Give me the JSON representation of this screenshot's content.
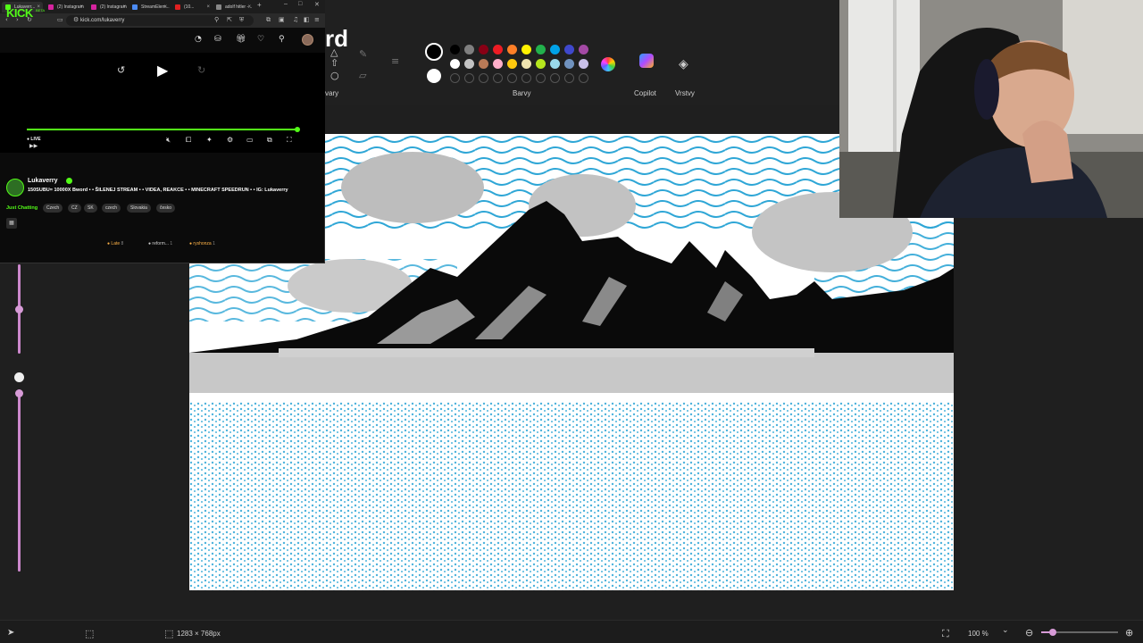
{
  "browser": {
    "tabs": [
      {
        "label": "Lukaverr...",
        "fav": "#53fc18",
        "active": true
      },
      {
        "label": "(2) Instagram",
        "fav": "#d6249f",
        "active": false
      },
      {
        "label": "(2) Instagram",
        "fav": "#d6249f",
        "active": false
      },
      {
        "label": "StreamElem...",
        "fav": "#4b8bf5",
        "active": false
      },
      {
        "label": "(10...",
        "fav": "#e02020",
        "active": false
      },
      {
        "label": "adolf hitler -...",
        "fav": "#888888",
        "active": false
      }
    ],
    "url": "kick.com/lukaverry"
  },
  "kick": {
    "logo": "KICK",
    "logo_badge": "BETA",
    "live_label": "LIVE",
    "channel": {
      "name": "Lukaverry",
      "title": "150SUBU= 10000X Bword • • ŠILENEJ STREAM • • VIDEA, REAKCE • • MINECRAFT SPEEDRUN • • IG: Lukaverry",
      "category": "Just Chatting",
      "tags": [
        "Czech",
        "CZ",
        "SK",
        "czech",
        "Slovakia",
        "česko"
      ]
    },
    "chat_users": [
      {
        "name": "Late",
        "count": "8"
      },
      {
        "name": "reform...",
        "count": "1"
      },
      {
        "name": "ryshonza",
        "count": "1"
      }
    ]
  },
  "paint": {
    "title_fragment": "rd",
    "groups": {
      "tools_label": "vary",
      "colors_label": "Barvy",
      "copilot_label": "Copilot",
      "layers_label": "Vrstvy"
    },
    "colors_row1": [
      "#000000",
      "#7f7f7f",
      "#880015",
      "#ed1c24",
      "#ff7f27",
      "#fff200",
      "#22b14c",
      "#00a2e8",
      "#3f48cc",
      "#a349a4"
    ],
    "colors_row2": [
      "#ffffff",
      "#c3c3c3",
      "#b97a57",
      "#ffaec9",
      "#ffc90e",
      "#efe4b0",
      "#b5e61d",
      "#99d9ea",
      "#7092be",
      "#c8bfe7"
    ],
    "status": {
      "canvas_size": "1283 × 768px",
      "zoom": "100 %",
      "zoom_level": 0.15
    }
  }
}
